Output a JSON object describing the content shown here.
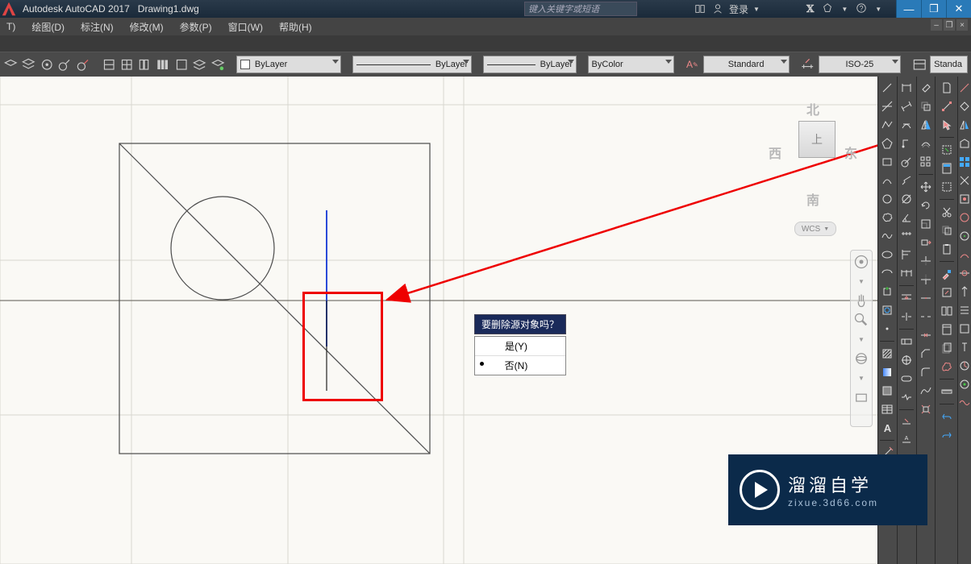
{
  "titlebar": {
    "app": "Autodesk AutoCAD 2017",
    "file": "Drawing1.dwg",
    "search_placeholder": "键入关键字或短语",
    "login": "登录"
  },
  "menu": {
    "items": [
      "T)",
      "绘图(D)",
      "标注(N)",
      "修改(M)",
      "参数(P)",
      "窗口(W)",
      "帮助(H)"
    ]
  },
  "props": {
    "layer": "ByLayer",
    "ltype": "ByLayer",
    "lweight": "ByLayer",
    "color": "ByColor",
    "textstyle": "Standard",
    "dimstyle": "ISO-25",
    "tablestyle": "Standa"
  },
  "navcube": {
    "n": "北",
    "s": "南",
    "e": "东",
    "w": "西",
    "top": "上",
    "wcs": "WCS"
  },
  "prompt": {
    "question": "要删除源对象吗？",
    "yes": "是(Y)",
    "no": "否(N)"
  },
  "watermark": {
    "line1": "溜溜自学",
    "line2": "zixue.3d66.com"
  }
}
